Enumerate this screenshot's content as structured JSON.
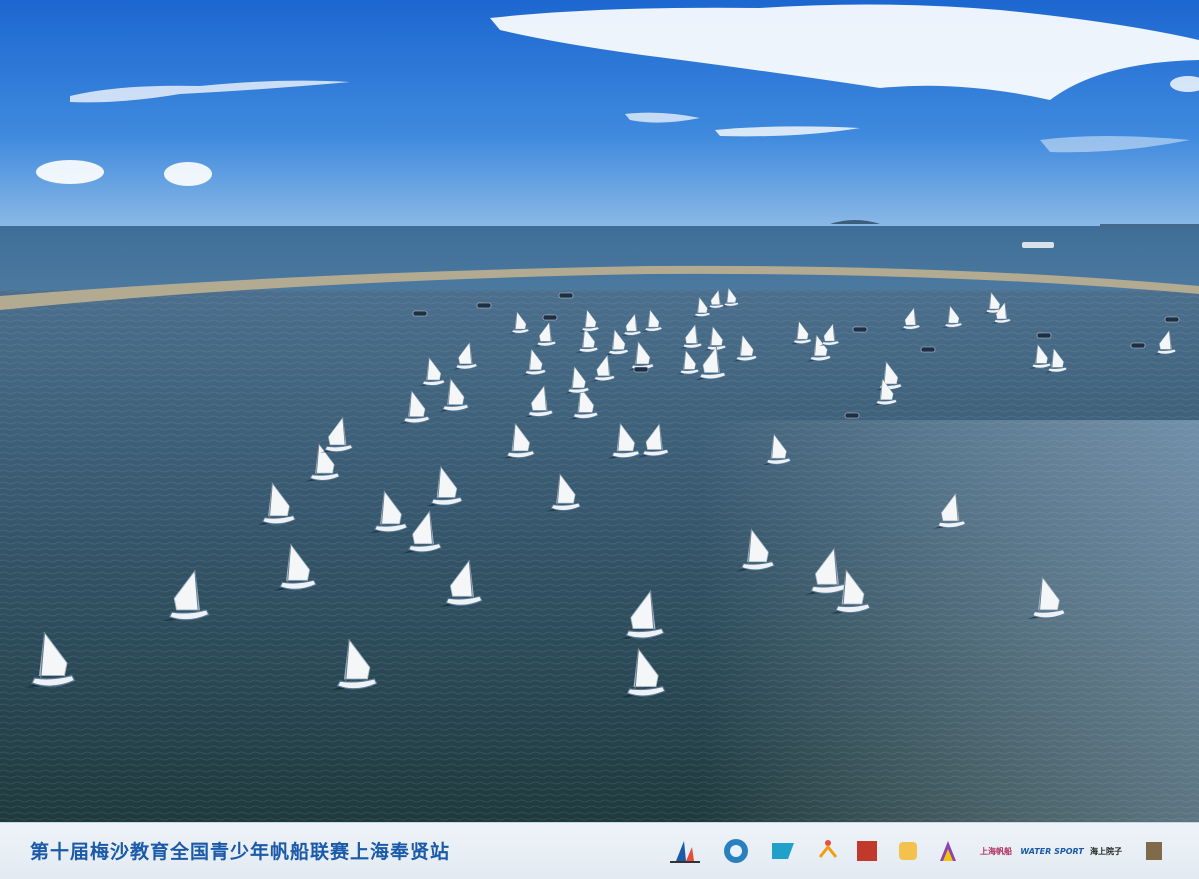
{
  "banner": {
    "title": "第十届梅沙教育全国青少年帆船联赛上海奉贤站",
    "logos": [
      {
        "name": "sail-event-logo",
        "text": ""
      },
      {
        "name": "circle-emblem-logo",
        "text": ""
      },
      {
        "name": "blue-flag-logo",
        "text": ""
      },
      {
        "name": "sport-figure-logo",
        "text": ""
      },
      {
        "name": "red-seal-logo",
        "text": ""
      },
      {
        "name": "yellow-badge-logo",
        "text": ""
      },
      {
        "name": "colorful-mark-logo",
        "text": ""
      },
      {
        "name": "shanghai-sailing-logo",
        "text": "上海帆船"
      },
      {
        "name": "water-sport-logo",
        "text": "WATER SPORT"
      },
      {
        "name": "haishang-yuanzi-logo",
        "text": "海上院子"
      },
      {
        "name": "end-badge-logo",
        "text": ""
      }
    ]
  },
  "colors": {
    "sky_top": "#1f6fd6",
    "sky_bottom": "#7fb2e6",
    "sea_far": "#3f6f9a",
    "sea_near": "#1f3b3a",
    "breakwater": "#b3aa92",
    "sail": "#f4f6f8",
    "banner_text": "#1b5aa8"
  }
}
